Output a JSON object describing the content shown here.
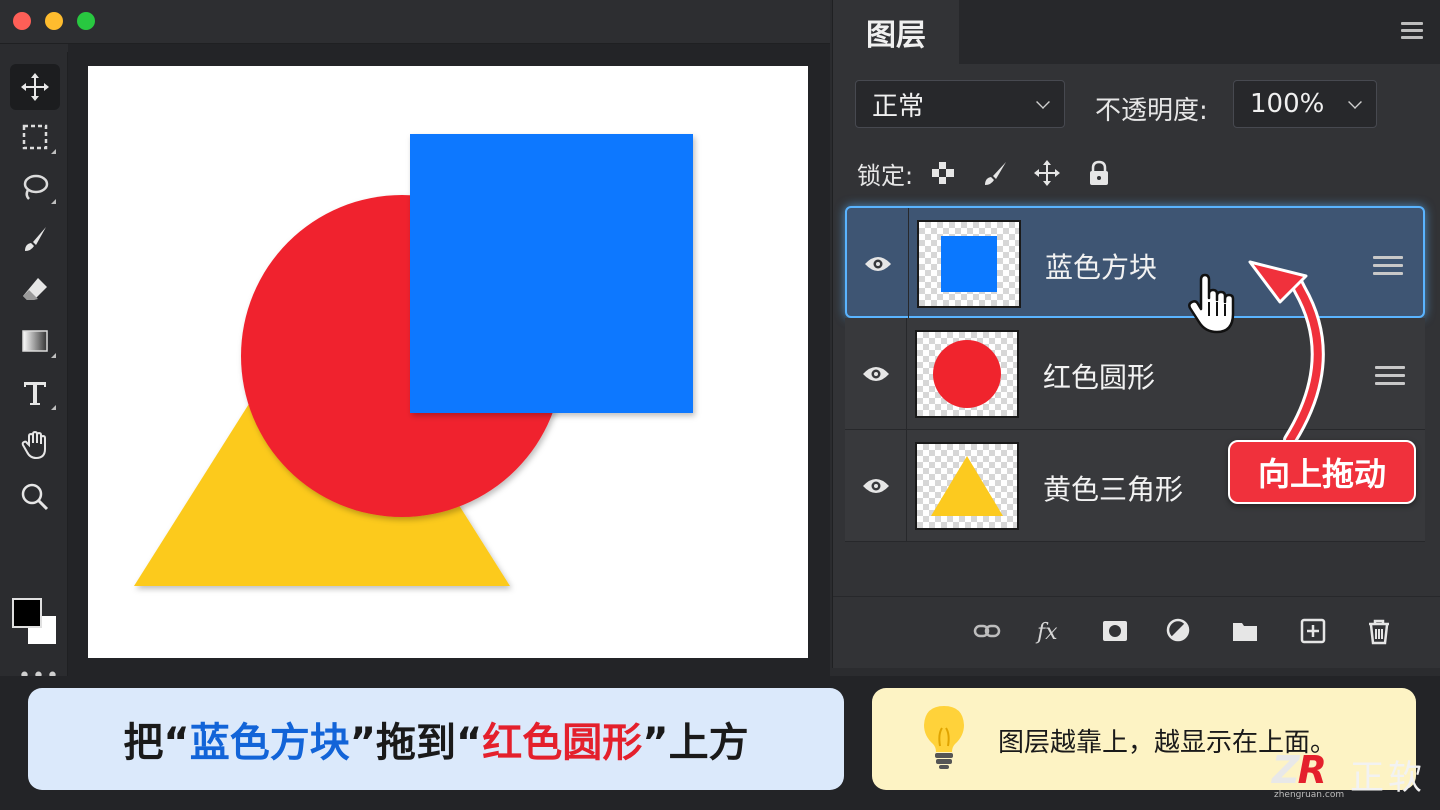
{
  "panel": {
    "title": "图层",
    "blend_mode": "正常",
    "opacity_label": "不透明度:",
    "opacity_value": "100%",
    "lock_label": "锁定:"
  },
  "layers": [
    {
      "name": "蓝色方块",
      "selected": true,
      "shape": "square",
      "color": "#0a78ff"
    },
    {
      "name": "红色圆形",
      "selected": false,
      "shape": "circle",
      "color": "#f0242d"
    },
    {
      "name": "黄色三角形",
      "selected": false,
      "shape": "triangle",
      "color": "#fcca1f"
    }
  ],
  "annotation": {
    "drag_label": "向上拖动"
  },
  "caption": {
    "prefix": "把“",
    "layer_a": "蓝色方块",
    "middle": "”拖到“",
    "layer_b": "红色圆形",
    "suffix": "”上方"
  },
  "tip": {
    "text": "图层越靠上，越显示在上面。"
  },
  "logo": {
    "mark_z": "Z",
    "mark_r": "R",
    "brand": "正软",
    "url": "zhengruan.com"
  },
  "colors": {
    "blue": "#0a78ff",
    "red": "#f0242d",
    "yellow": "#fcca1f",
    "selection": "#5ab4ff",
    "drag_tag": "#f0313c"
  },
  "tools": [
    "move-icon",
    "marquee-icon",
    "lasso-icon",
    "brush-icon",
    "eraser-icon",
    "gradient-icon",
    "type-icon",
    "hand-icon",
    "zoom-icon"
  ]
}
